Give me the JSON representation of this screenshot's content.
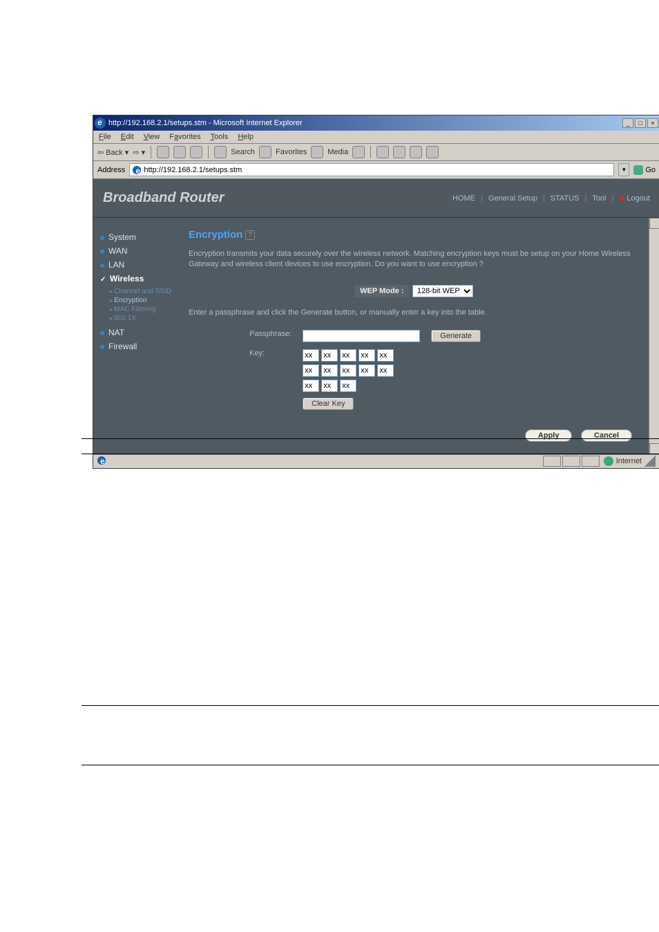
{
  "titlebar": {
    "text": "http://192.168.2.1/setups.stm - Microsoft Internet Explorer"
  },
  "menubar": [
    "File",
    "Edit",
    "View",
    "Favorites",
    "Tools",
    "Help"
  ],
  "toolbar": {
    "back": "Back",
    "search": "Search",
    "fav": "Favorites",
    "media": "Media"
  },
  "address": {
    "label": "Address",
    "url": "http://192.168.2.1/setups.stm",
    "go": "Go"
  },
  "brand": "Broadband Router",
  "toplinks": [
    "HOME",
    "General Setup",
    "STATUS",
    "Tool",
    "Logout"
  ],
  "sidebar": {
    "system": "System",
    "wan": "WAN",
    "lan": "LAN",
    "wireless": "Wireless",
    "nat": "NAT",
    "firewall": "Firewall",
    "children": [
      "Channel and SSID",
      "Encryption",
      "MAC Filtering",
      "802.1X"
    ]
  },
  "main": {
    "title": "Encryption",
    "intro": "Encryption transmits your data securely over the wireless network. Matching encryption keys must be setup on your Home Wireless Gateway and wireless client devices to use encryption. Do you want to use encryption ?",
    "wepmode_label": "WEP Mode :",
    "wepmode_value": "128-bit WEP",
    "instruction": "Enter a passphrase and click the Generate button, or manually enter a key into the table.",
    "passphrase_label": "Passphrase:",
    "key_label": "Key:",
    "generate": "Generate",
    "clearkey": "Clear Key",
    "apply": "Apply",
    "cancel": "Cancel",
    "keyvals": [
      "xx",
      "xx",
      "xx",
      "xx",
      "xx",
      "xx",
      "xx",
      "xx",
      "xx",
      "xx",
      "xx",
      "xx",
      "xx"
    ]
  },
  "status": {
    "done": "",
    "internet": "Internet"
  }
}
